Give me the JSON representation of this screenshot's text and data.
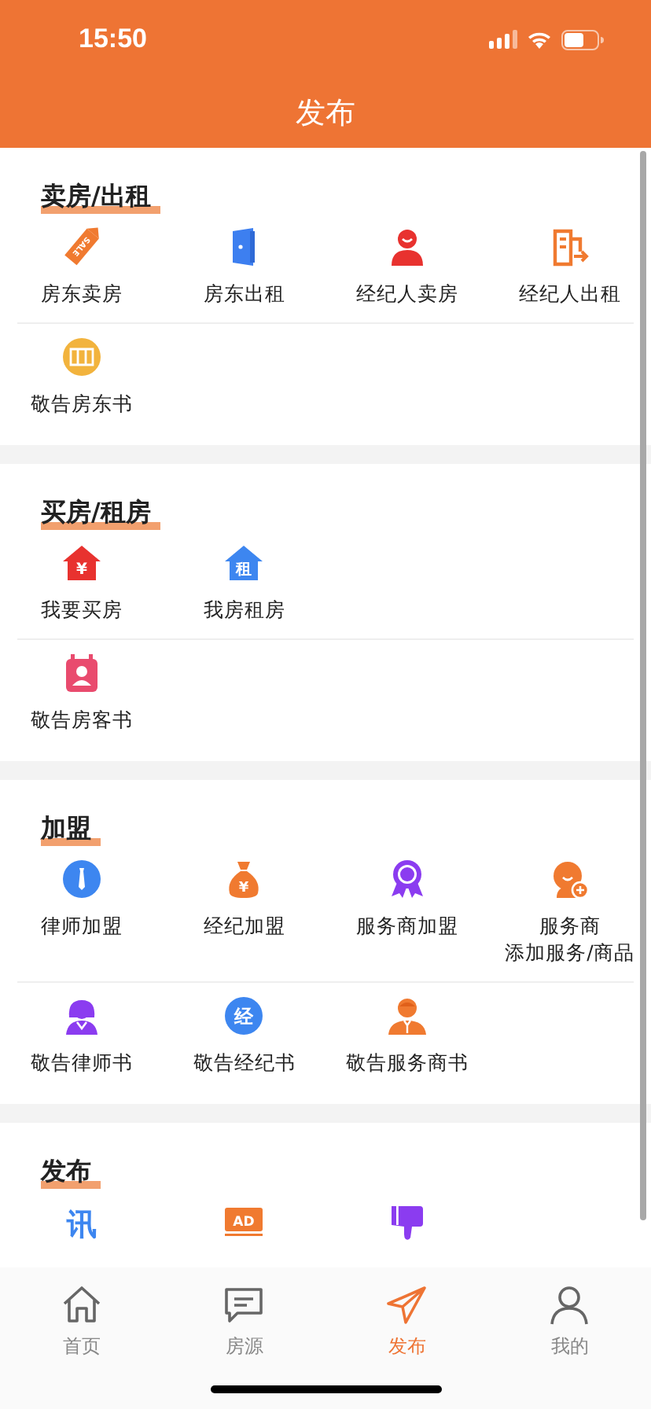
{
  "status_bar": {
    "time": "15:50"
  },
  "header": {
    "title": "发布"
  },
  "sections": [
    {
      "title": "卖房/出租",
      "rows": [
        [
          {
            "label": "房东卖房",
            "icon_text": "SALE"
          },
          {
            "label": "房东出租"
          },
          {
            "label": "经纪人卖房"
          },
          {
            "label": "经纪人出租"
          }
        ],
        [
          {
            "label": "敬告房东书"
          }
        ]
      ]
    },
    {
      "title": "买房/租房",
      "rows": [
        [
          {
            "label": "我要买房",
            "icon_text": "¥"
          },
          {
            "label": "我房租房",
            "icon_text": "租"
          }
        ],
        [
          {
            "label": "敬告房客书"
          }
        ]
      ]
    },
    {
      "title": "加盟",
      "rows": [
        [
          {
            "label": "律师加盟"
          },
          {
            "label": "经纪加盟",
            "icon_text": "¥"
          },
          {
            "label": "服务商加盟"
          },
          {
            "label": "服务商",
            "label_2": "添加服务/商品"
          }
        ],
        [
          {
            "label": "敬告律师书"
          },
          {
            "label": "敬告经纪书",
            "icon_text": "经"
          },
          {
            "label": "敬告服务商书"
          }
        ]
      ]
    },
    {
      "title": "发布",
      "rows": [
        [
          {
            "icon_text": "讯"
          },
          {
            "icon_text": "AD"
          },
          {}
        ]
      ]
    }
  ],
  "tabs": [
    {
      "label": "首页",
      "selected": false
    },
    {
      "label": "房源",
      "selected": false
    },
    {
      "label": "发布",
      "selected": true
    },
    {
      "label": "我的",
      "selected": false
    }
  ]
}
